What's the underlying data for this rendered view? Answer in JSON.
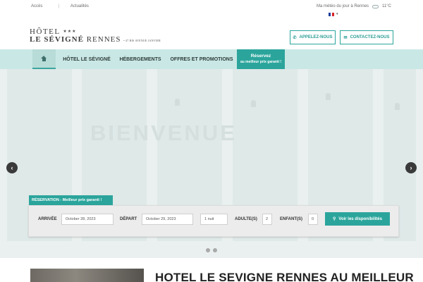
{
  "topbar": {
    "links": [
      "Accès",
      "Actualités"
    ],
    "separator": "|",
    "weather_label": "Ma météo du jour à Rennes",
    "weather_temp": "11°C",
    "lang_caret": "▾"
  },
  "logo": {
    "line1": "HÔTEL",
    "stars": "★★★",
    "line2a": "LE SÉVIGNÉ",
    "line2b": " RENNES",
    "address": "• 47 BIS AVENUE JANVIER"
  },
  "header_buttons": {
    "call_label": "APPELEZ-NOUS",
    "contact_label": "CONTACTEZ-NOUS"
  },
  "nav": {
    "items": [
      "HÔTEL LE SÉVIGNÉ",
      "HÉBERGEMENTS",
      "OFFRES ET PROMOTIONS"
    ],
    "reserve_title": "Réservez",
    "reserve_sub": "au meilleur prix garanti !"
  },
  "hero": {
    "word": "BIENVENUE",
    "prev": "‹",
    "next": "›"
  },
  "booking": {
    "tab_label": "RÉSERVATION - Meilleur prix garanti !",
    "arrival_label": "ARRIVÉE",
    "arrival_value": "October 28, 2023",
    "departure_label": "DÉPART",
    "departure_value": "October 29, 2023",
    "nights_value": "1 nuit",
    "adults_label": "ADULTE(S)",
    "adults_value": "2",
    "children_label": "ENFANT(S)",
    "children_value": "0",
    "search_label": "Voir les disponibilités"
  },
  "bottom": {
    "headline": "HOTEL LE SEVIGNE RENNES AU MEILLEUR"
  },
  "colors": {
    "accent": "#2ba59c",
    "nav_bg": "#c9e8e5",
    "hero_bg": "#e9f0ef"
  },
  "icons": {
    "phone": "phone-icon",
    "mail": "mail-icon",
    "search": "search-icon",
    "home": "home-icon",
    "weather": "cloud-icon",
    "flag": "france-flag-icon"
  }
}
